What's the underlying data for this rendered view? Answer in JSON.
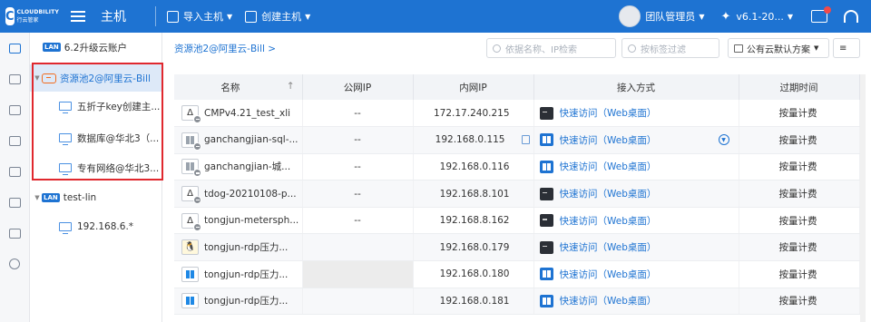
{
  "header": {
    "logo_text_1": "CLOUDBILITY",
    "logo_text_2": "行云管家",
    "module_title": "主机",
    "import_label": "导入主机",
    "create_label": "创建主机",
    "user_name": "团队管理员",
    "version": "v6.1-20..."
  },
  "rail": [
    "monitor-icon",
    "topology-icon",
    "list-icon",
    "clipboard-icon",
    "document-icon",
    "activity-icon",
    "shield-icon",
    "gear-icon"
  ],
  "tree": {
    "items": [
      {
        "label": "6.2升级云账户",
        "tag": "LAN"
      },
      {
        "label": "资源池2@阿里云-Bill"
      },
      {
        "label": "五折子key创建主..."
      },
      {
        "label": "数据库@华北3（..."
      },
      {
        "label": "专有网络@华北3..."
      },
      {
        "label": "test-lin",
        "tag": "LAN"
      },
      {
        "label": "192.168.6.*"
      }
    ]
  },
  "main": {
    "breadcrumb": "资源池2@阿里云-Bill  >",
    "search_placeholder": "依据名称、IP检索",
    "tag_filter_placeholder": "按标签过滤",
    "plan_label": "公有云默认方案"
  },
  "table": {
    "headers": {
      "name": "名称",
      "sort_arrow": "↑",
      "public_ip": "公网IP",
      "private_ip": "内网IP",
      "access": "接入方式",
      "expiry": "过期时间"
    },
    "rows": [
      {
        "name": "CMPv4.21_test_xli",
        "public_ip": "--",
        "private_ip": "172.17.240.215",
        "access": "快速访问（Web桌面）",
        "expiry": "按量计费"
      },
      {
        "name": "ganchangjian-sql-...",
        "public_ip": "--",
        "private_ip": "192.168.0.115",
        "access": "快速访问（Web桌面）",
        "expiry": "按量计费"
      },
      {
        "name": "ganchangjian-城...",
        "public_ip": "--",
        "private_ip": "192.168.0.116",
        "access": "快速访问（Web桌面）",
        "expiry": "按量计费"
      },
      {
        "name": "tdog-20210108-p...",
        "public_ip": "--",
        "private_ip": "192.168.8.101",
        "access": "快速访问（Web桌面）",
        "expiry": "按量计费"
      },
      {
        "name": "tongjun-metersph...",
        "public_ip": "--",
        "private_ip": "192.168.8.162",
        "access": "快速访问（Web桌面）",
        "expiry": "按量计费"
      },
      {
        "name": "tongjun-rdp压力...",
        "public_ip": "",
        "private_ip": "192.168.0.179",
        "access": "快速访问（Web桌面）",
        "expiry": "按量计费"
      },
      {
        "name": "tongjun-rdp压力...",
        "public_ip": "",
        "private_ip": "192.168.0.180",
        "access": "快速访问（Web桌面）",
        "expiry": "按量计费"
      },
      {
        "name": "tongjun-rdp压力...",
        "public_ip": "",
        "private_ip": "192.168.0.181",
        "access": "快速访问（Web桌面）",
        "expiry": "按量计费"
      }
    ]
  }
}
